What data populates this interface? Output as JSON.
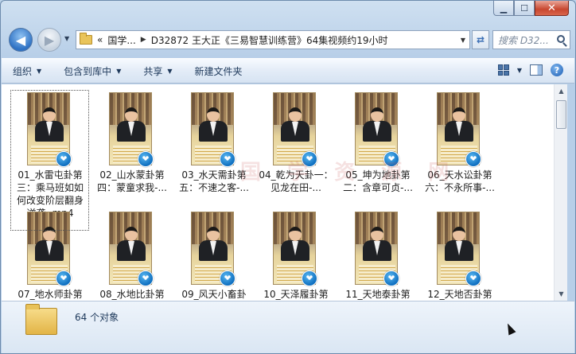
{
  "window": {
    "caption": {
      "minimize": "▁",
      "maximize": "☐",
      "close": "✕"
    }
  },
  "nav": {
    "back": "◀",
    "forward": "▶",
    "breadcrumb": [
      {
        "label": "«"
      },
      {
        "label": "国学..."
      },
      {
        "label": "D32872 王大正《三易智慧训练营》64集视频约19小时"
      }
    ],
    "search_placeholder": "搜索 D32..."
  },
  "toolbar": {
    "organize": "组织",
    "include_in_library": "包含到库中",
    "share": "共享",
    "new_folder": "新建文件夹"
  },
  "files": [
    {
      "name": "01_水雷屯卦第三：乘马班如如何改变阶层翻身逆袭-.mp4",
      "selected": true
    },
    {
      "name": "02_山水蒙卦第四：蒙童求我-...",
      "selected": false
    },
    {
      "name": "03_水天需卦第五：不速之客-...",
      "selected": false
    },
    {
      "name": "04_乾为天卦一：见龙在田-...",
      "selected": false
    },
    {
      "name": "05_坤为地卦第二：含章可贞-...",
      "selected": false
    },
    {
      "name": "06_天水讼卦第六：不永所事-...",
      "selected": false
    },
    {
      "name": "07_地水师卦第",
      "selected": false
    },
    {
      "name": "08_水地比卦第",
      "selected": false
    },
    {
      "name": "09_风天小畜卦",
      "selected": false
    },
    {
      "name": "10_天泽履卦第",
      "selected": false
    },
    {
      "name": "11_天地泰卦第",
      "selected": false
    },
    {
      "name": "12_天地否卦第",
      "selected": false
    }
  ],
  "watermark": "国 学 资 源 网",
  "status": {
    "count_text": "64 个对象"
  }
}
